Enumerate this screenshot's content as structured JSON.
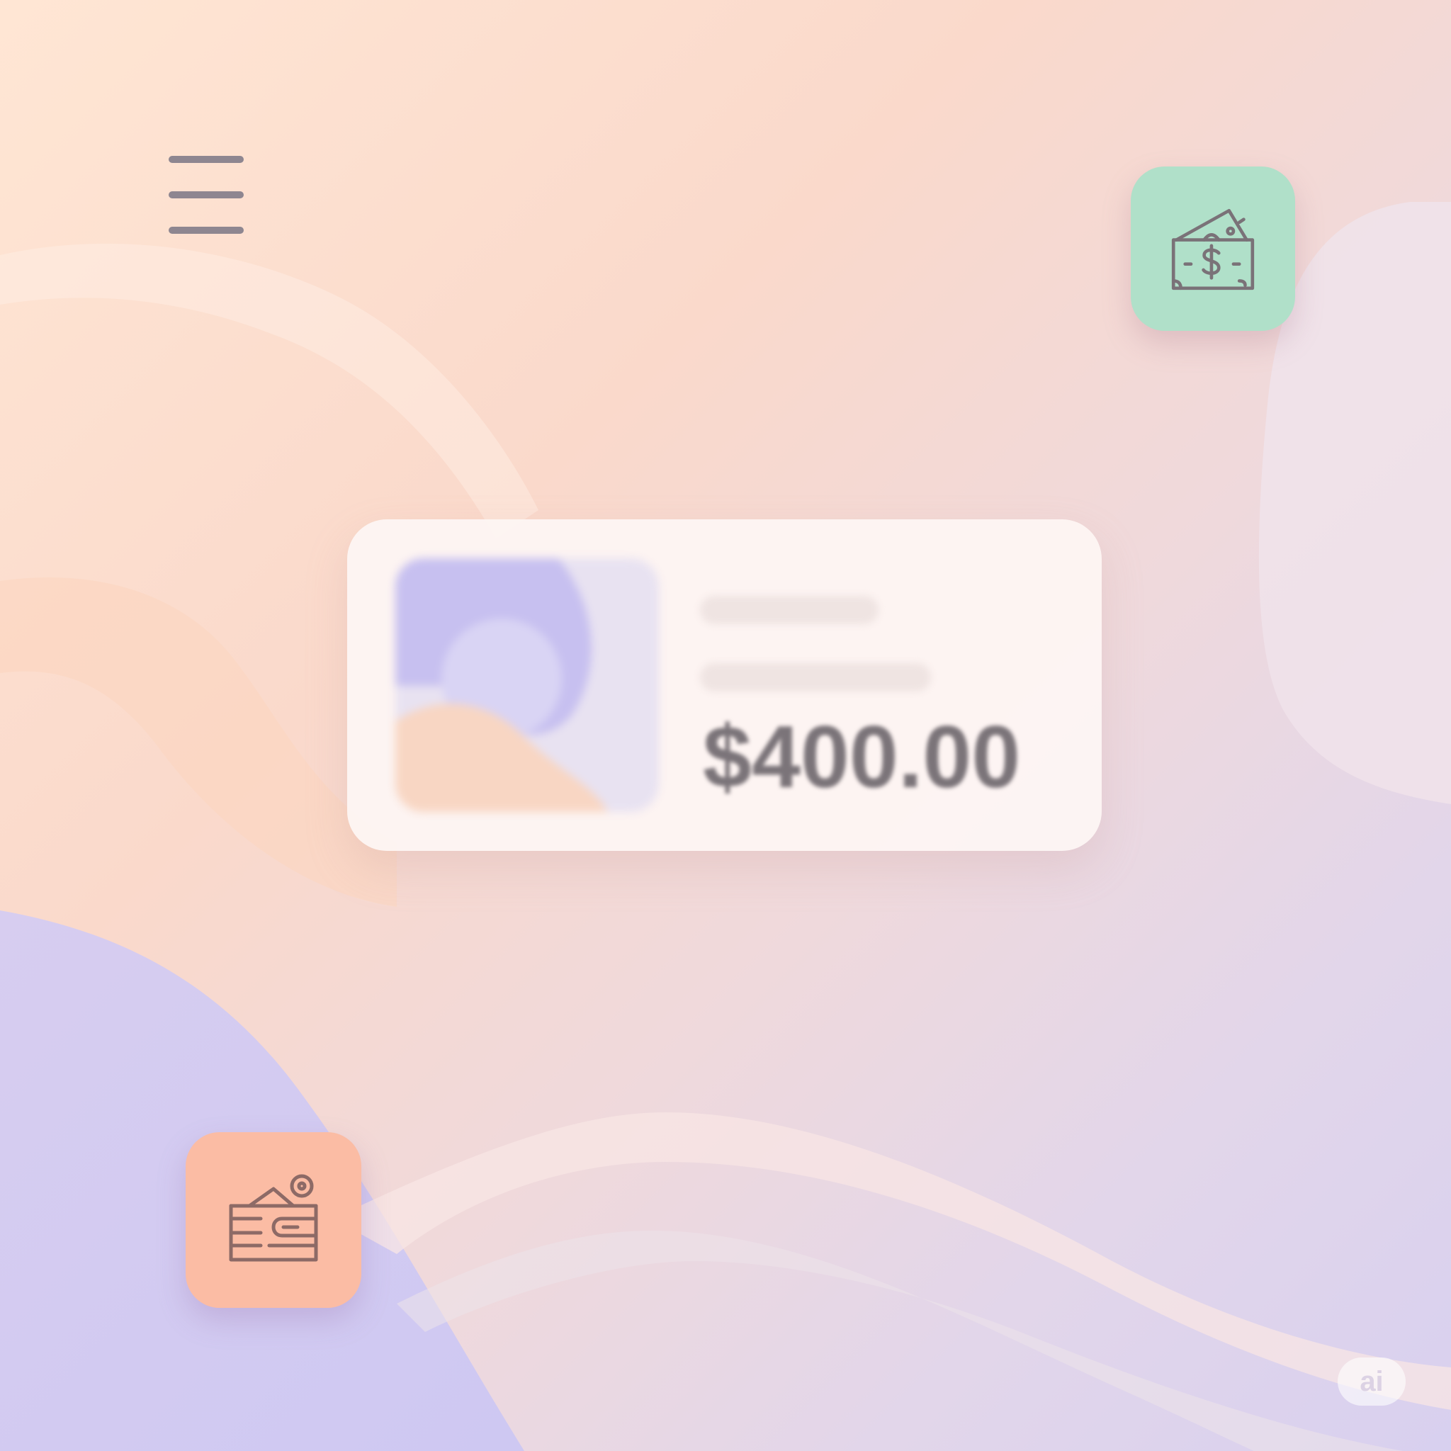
{
  "menu": {
    "icon": "hamburger-menu-icon"
  },
  "quick_actions": [
    {
      "icon": "money-cash-icon",
      "color": "#b0e0c9"
    },
    {
      "icon": "wallet-coin-icon",
      "color": "#fbbca4"
    }
  ],
  "card": {
    "thumbnail_icon": "image-placeholder",
    "price": "$400.00"
  },
  "badge": {
    "label": "ai"
  },
  "colors": {
    "background_top": "#ffe6d4",
    "background_bottom": "#d8d0ef",
    "icon_stroke": "#7a7278",
    "price_text": "#7b7479"
  }
}
